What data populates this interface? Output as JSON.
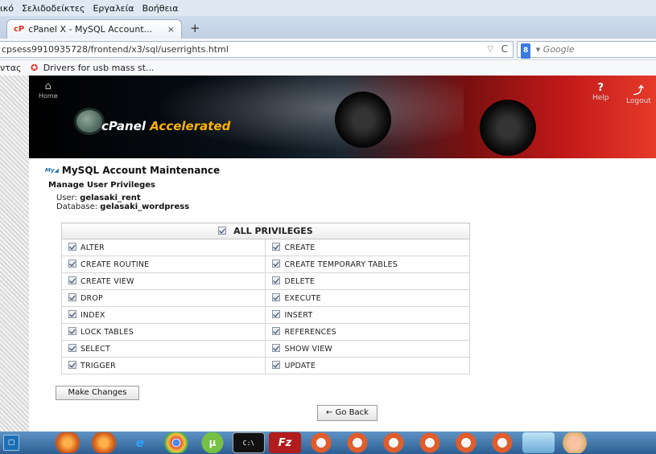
{
  "browser": {
    "menu": [
      "ικό",
      "Σελιδοδείκτες",
      "Εργαλεία",
      "Βοήθεια"
    ],
    "tab": {
      "favicon": "cP",
      "title": "cPanel X - MySQL Account...",
      "close": "×",
      "new_tab": "+"
    },
    "url": "cpsess9910935728/frontend/x3/sql/userrights.html",
    "reload": "C",
    "search": {
      "badge": "8",
      "placeholder": "Google"
    },
    "bookmarks": {
      "prefix": "ντας",
      "item": "Drivers for usb mass st..."
    }
  },
  "banner": {
    "home": "Home",
    "help": "Help",
    "logout": "Logout",
    "logo_brand": "cPanel",
    "logo_accent": "Accelerated"
  },
  "page": {
    "title": "MySQL Account Maintenance",
    "subtitle": "Manage User Privileges",
    "user_label": "User:",
    "user_value": "gelasaki_rent",
    "database_label": "Database:",
    "database_value": "gelasaki_wordpress",
    "all_privileges": "ALL PRIVILEGES",
    "privileges": [
      [
        "ALTER",
        "CREATE"
      ],
      [
        "CREATE ROUTINE",
        "CREATE TEMPORARY TABLES"
      ],
      [
        "CREATE VIEW",
        "DELETE"
      ],
      [
        "DROP",
        "EXECUTE"
      ],
      [
        "INDEX",
        "INSERT"
      ],
      [
        "LOCK TABLES",
        "REFERENCES"
      ],
      [
        "SELECT",
        "SHOW VIEW"
      ],
      [
        "TRIGGER",
        "UPDATE"
      ]
    ],
    "make_changes": "Make Changes",
    "go_back": "← Go Back"
  },
  "taskbar": {
    "icons": [
      "start-icon",
      "firefox-icon",
      "firefox-icon",
      "internet-explorer-icon",
      "chrome-icon",
      "utorrent-icon",
      "command-prompt-icon",
      "filezilla-icon",
      "openoffice-icon",
      "openoffice-icon",
      "openoffice-icon",
      "openoffice-icon",
      "openoffice-icon",
      "openoffice-icon",
      "app-icon",
      "app-icon"
    ]
  }
}
